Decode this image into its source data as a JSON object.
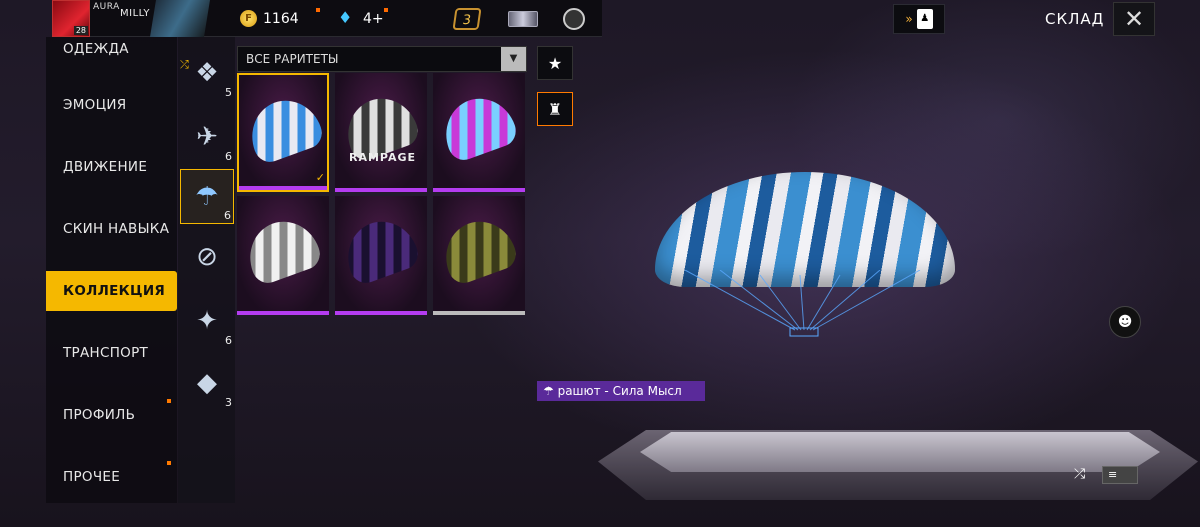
{
  "header": {
    "player_level": "28",
    "player_name_1": "AURA",
    "player_name_2": "MILLY",
    "gold_icon": "F",
    "gold": "1164",
    "diamonds": "4+",
    "rank_badge": "3",
    "store_title": "СКЛАД",
    "close_icon": "✕"
  },
  "left_menu": [
    {
      "label": "ОДЕЖДА",
      "active": false
    },
    {
      "label": "ЭМОЦИЯ",
      "active": false
    },
    {
      "label": "ДВИЖЕНИЕ",
      "active": false
    },
    {
      "label": "СКИН НАВЫКА",
      "active": false
    },
    {
      "label": "КОЛЛЕКЦИЯ",
      "active": true
    },
    {
      "label": "ТРАНСПОРТ",
      "active": false
    },
    {
      "label": "ПРОФИЛЬ",
      "active": false
    },
    {
      "label": "ПРОЧЕЕ",
      "active": false
    }
  ],
  "categories": [
    {
      "icon": "backpack-icon",
      "count": "5"
    },
    {
      "icon": "glider-icon",
      "count": "6"
    },
    {
      "icon": "parachute-icon",
      "count": "6"
    },
    {
      "icon": "skyboard-icon",
      "count": ""
    },
    {
      "icon": "weapon-charm-icon",
      "count": "6"
    },
    {
      "icon": "banner-icon",
      "count": "3"
    }
  ],
  "filter": {
    "label": "ВСЕ РАРИТЕТЫ",
    "dropdown_icon": "▼"
  },
  "grid_items": [
    {
      "name": "parachute-mind-power",
      "tag": "",
      "colors": [
        "#e9e9f2",
        "#3a8ee0"
      ],
      "rarity": "purple",
      "selected": true
    },
    {
      "name": "parachute-rampage",
      "tag": "RAMPAGE",
      "colors": [
        "#e0e0e0",
        "#3a3a3a"
      ],
      "rarity": "purple",
      "selected": false
    },
    {
      "name": "parachute-neon",
      "tag": "",
      "colors": [
        "#c83ad8",
        "#7ad0ff"
      ],
      "rarity": "purple",
      "selected": false
    },
    {
      "name": "parachute-silver",
      "tag": "",
      "colors": [
        "#f0f0f0",
        "#888888"
      ],
      "rarity": "purple",
      "selected": false
    },
    {
      "name": "parachute-dark-purple",
      "tag": "",
      "colors": [
        "#4a2a7a",
        "#1a1030"
      ],
      "rarity": "purple",
      "selected": false
    },
    {
      "name": "parachute-olive",
      "tag": "",
      "colors": [
        "#8a8a3a",
        "#3a3a1a"
      ],
      "rarity": "white",
      "selected": false
    }
  ],
  "side_buttons": [
    {
      "icon": "star-icon",
      "glyph": "★"
    },
    {
      "icon": "mannequin-icon",
      "glyph": "♜"
    }
  ],
  "preview": {
    "item_label": "рашют - Сила Мысл",
    "item_icon": "parachute-icon"
  },
  "controls": {
    "shuffle_glyph": "⤮",
    "list_glyph": "≡"
  }
}
